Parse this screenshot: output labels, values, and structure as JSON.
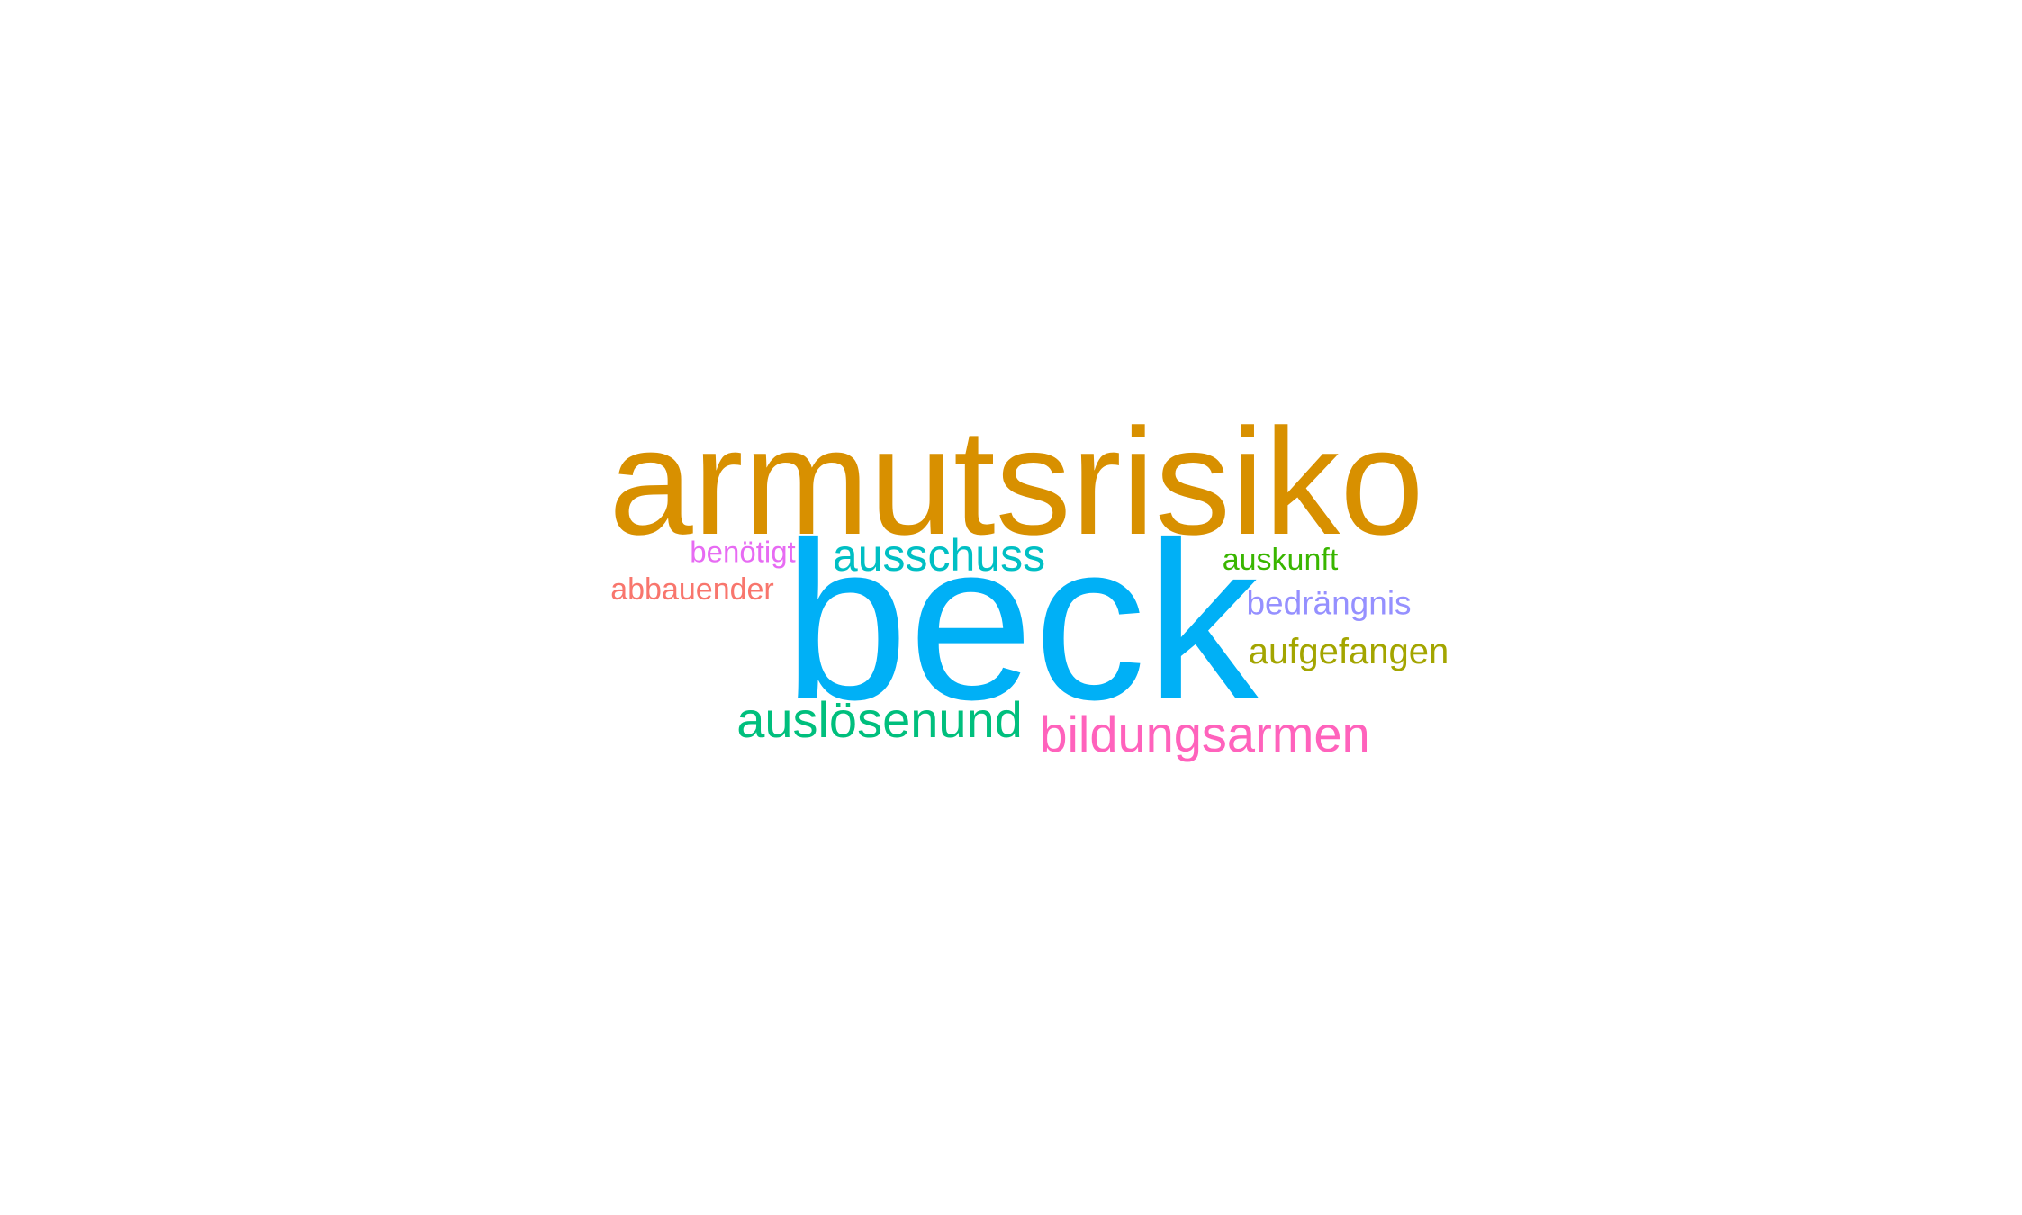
{
  "words": [
    {
      "text": "armutsrisiko",
      "color": "#D89000"
    },
    {
      "text": "beck",
      "color": "#00B0F6"
    },
    {
      "text": "ausschuss",
      "color": "#00BFC4"
    },
    {
      "text": "benötigt",
      "color": "#E76BF3"
    },
    {
      "text": "abbauender",
      "color": "#F8766D"
    },
    {
      "text": "auskunft",
      "color": "#39B600"
    },
    {
      "text": "bedrängnis",
      "color": "#9590FF"
    },
    {
      "text": "aufgefangen",
      "color": "#A3A500"
    },
    {
      "text": "auslösenund",
      "color": "#00BF7D"
    },
    {
      "text": "bildungsarmen",
      "color": "#FF62BC"
    }
  ]
}
